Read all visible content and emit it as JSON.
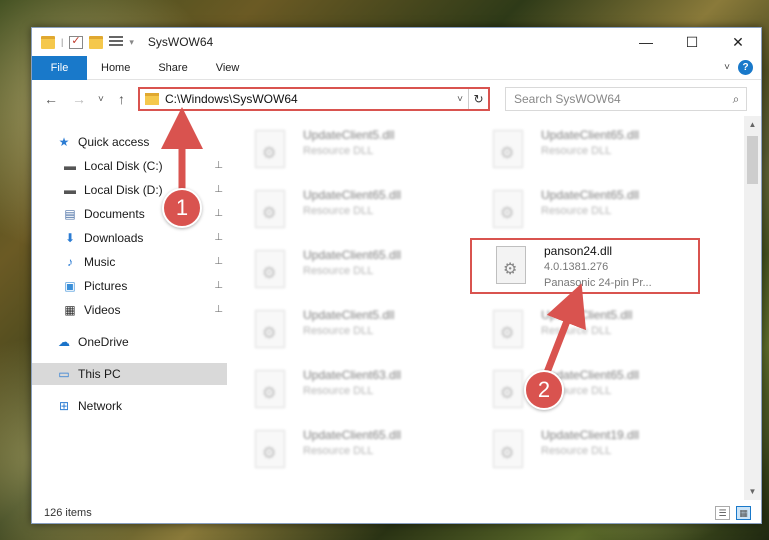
{
  "window": {
    "title": "SysWOW64",
    "controls": {
      "minimize": "—",
      "maximize": "☐",
      "close": "✕"
    }
  },
  "ribbon": {
    "file": "File",
    "tabs": [
      "Home",
      "Share",
      "View"
    ],
    "help": "?"
  },
  "nav": {
    "back": "←",
    "forward": "→",
    "recent": "˅",
    "up": "↑",
    "address": "C:\\Windows\\SysWOW64",
    "search_placeholder": "Search SysWOW64"
  },
  "sidebar": {
    "items": [
      {
        "label": "Quick access",
        "icon": "star-icon",
        "glyph": "★",
        "color": "#2b7cd3"
      },
      {
        "label": "Local Disk (C:)",
        "icon": "drive-icon",
        "glyph": "▬",
        "color": "#555"
      },
      {
        "label": "Local Disk (D:)",
        "icon": "drive-icon",
        "glyph": "▬",
        "color": "#555"
      },
      {
        "label": "Documents",
        "icon": "document-icon",
        "glyph": "▤",
        "color": "#4a6fa5"
      },
      {
        "label": "Downloads",
        "icon": "download-icon",
        "glyph": "⬇",
        "color": "#2b7cd3"
      },
      {
        "label": "Music",
        "icon": "music-icon",
        "glyph": "♪",
        "color": "#2b7cd3"
      },
      {
        "label": "Pictures",
        "icon": "pictures-icon",
        "glyph": "▣",
        "color": "#3a8fd9"
      },
      {
        "label": "Videos",
        "icon": "videos-icon",
        "glyph": "▦",
        "color": "#333"
      },
      {
        "label": "OneDrive",
        "icon": "cloud-icon",
        "glyph": "☁",
        "color": "#1a73c9"
      },
      {
        "label": "This PC",
        "icon": "computer-icon",
        "glyph": "▭",
        "color": "#2b7cd3"
      },
      {
        "label": "Network",
        "icon": "network-icon",
        "glyph": "⊞",
        "color": "#2b7cd3"
      }
    ],
    "pin": "📌"
  },
  "files": {
    "resource_label": "Resource DLL",
    "left_column": [
      "UpdateClient5.dll",
      "UpdateClient65.dll",
      "UpdateClient65.dll",
      "UpdateClient5.dll",
      "UpdateClient63.dll",
      "UpdateClient65.dll"
    ],
    "right_column": [
      "UpdateClient65.dll",
      "UpdateClient65.dll",
      "",
      "UpdateClient5.dll",
      "UpdateClient65.dll",
      "UpdateClient19.dll"
    ],
    "selected": {
      "name": "panson24.dll",
      "version": "4.0.1381.276",
      "description": "Panasonic 24-pin Pr..."
    }
  },
  "status": {
    "count": "126 items"
  },
  "annotations": {
    "step1": "1",
    "step2": "2",
    "color": "#d9534f"
  }
}
